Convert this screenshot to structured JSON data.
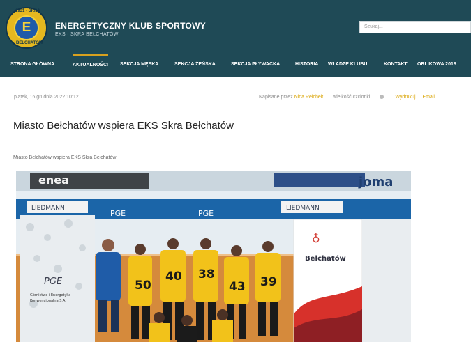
{
  "header": {
    "title": "ENERGETYCZNY KLUB SPORTOWY",
    "subtitle": "EKS · SKRA BEŁCHATÓW",
    "logo_top": "1931 · SKRA",
    "logo_letter": "E",
    "logo_bottom": "BEŁCHATÓW",
    "search_placeholder": "Szukaj..."
  },
  "nav": {
    "items": [
      "STRONA GŁÓWNA",
      "AKTUALNOŚCI",
      "SEKCJA MĘSKA",
      "SEKCJA ŻEŃSKA",
      "SEKCJA PŁYWACKA",
      "HISTORIA",
      "WŁADZE KLUBU",
      "KONTAKT",
      "ORLIKOWA 2018"
    ],
    "active": "AKTUALNOŚCI"
  },
  "article": {
    "date": "piątek, 16 grudnia 2022 10:12",
    "posted_by_label": "Napisane przez",
    "author": "Nina Reichelt",
    "font_size_label": "wielkość czcionki",
    "print": "Wydrukuj",
    "email": "Email",
    "title": "Miasto Bełchatów wspiera EKS Skra Bełchatów",
    "caption": "Miasto Bełchatów wspiera EKS Skra Bełchatów"
  },
  "photo": {
    "banner_left": "enea",
    "banner_right": "joma",
    "board_left": "LIEDMANN",
    "board_right": "LIEDMANN",
    "pge_left": "PGE",
    "pge_right": "PGE",
    "rollup_left_brand": "PGE",
    "rollup_left_text_1": "Górnictwo i Energetyka",
    "rollup_left_text_2": "Konwencjonalna S.A.",
    "rollup_right_brand": "Bełchatów",
    "jersey_numbers": [
      "50",
      "40",
      "38",
      "43",
      "39"
    ]
  },
  "colors": {
    "header_bg": "#1f4a56",
    "accent": "#d8a11f",
    "link": "#d9a300",
    "jersey": "#f2c21a"
  }
}
